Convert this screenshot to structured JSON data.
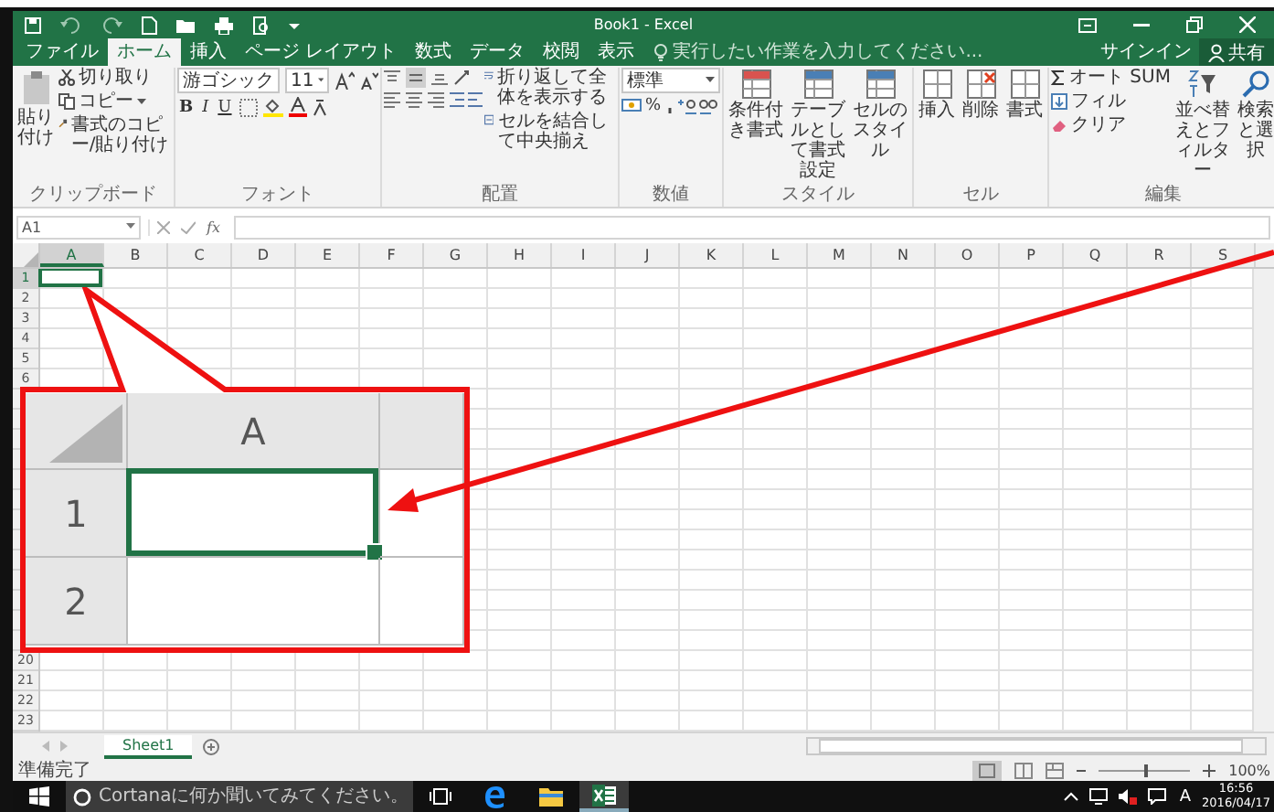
{
  "title_bar": {
    "title": "Book1 - Excel"
  },
  "tabs": [
    {
      "label": "ファイル",
      "selected": false
    },
    {
      "label": "ホーム",
      "selected": true
    },
    {
      "label": "挿入",
      "selected": false
    },
    {
      "label": "ページ レイアウト",
      "selected": false
    },
    {
      "label": "数式",
      "selected": false
    },
    {
      "label": "データ",
      "selected": false
    },
    {
      "label": "校閲",
      "selected": false
    },
    {
      "label": "表示",
      "selected": false
    }
  ],
  "tell_me": {
    "placeholder": "実行したい作業を入力してください..."
  },
  "account": {
    "sign_in": "サインイン",
    "share": "共有"
  },
  "ribbon": {
    "groups": [
      {
        "kind": "clipboard",
        "label": "クリップボード",
        "paste": "貼り付け",
        "cut": "切り取り",
        "copy": "コピー",
        "format_painter": "書式のコピー/貼り付け"
      },
      {
        "kind": "font",
        "label": "フォント",
        "font": "游ゴシック",
        "size": "11",
        "bold": "B",
        "italic": "I",
        "underline": "U"
      },
      {
        "kind": "alignment",
        "label": "配置",
        "wrap": "折り返して全体を表示する",
        "merge": "セルを結合して中央揃え"
      },
      {
        "kind": "number",
        "label": "数値",
        "format": "標準",
        "percent": "%"
      },
      {
        "kind": "styles",
        "label": "スタイル",
        "buttons": [
          "条件付き書式",
          "テーブルとして書式設定",
          "セルのスタイル"
        ]
      },
      {
        "kind": "cells",
        "label": "セル",
        "buttons": [
          "挿入",
          "削除",
          "書式"
        ]
      },
      {
        "kind": "editing",
        "label": "編集",
        "autosum": "オート SUM",
        "fill": "フィル",
        "clear": "クリア",
        "sort": "並べ替えとフィルター",
        "find": "検索と選択"
      }
    ]
  },
  "formula_bar": {
    "name_box": "A1",
    "fx": "fx"
  },
  "columns": [
    {
      "label": "A",
      "selected": true
    },
    {
      "label": "B",
      "selected": false
    },
    {
      "label": "C",
      "selected": false
    },
    {
      "label": "D",
      "selected": false
    },
    {
      "label": "E",
      "selected": false
    },
    {
      "label": "F",
      "selected": false
    },
    {
      "label": "G",
      "selected": false
    },
    {
      "label": "H",
      "selected": false
    },
    {
      "label": "I",
      "selected": false
    },
    {
      "label": "J",
      "selected": false
    },
    {
      "label": "K",
      "selected": false
    },
    {
      "label": "L",
      "selected": false
    },
    {
      "label": "M",
      "selected": false
    },
    {
      "label": "N",
      "selected": false
    },
    {
      "label": "O",
      "selected": false
    },
    {
      "label": "P",
      "selected": false
    },
    {
      "label": "Q",
      "selected": false
    },
    {
      "label": "R",
      "selected": false
    },
    {
      "label": "S",
      "selected": false
    }
  ],
  "rows_top": [
    {
      "label": "1",
      "selected": true
    },
    {
      "label": "2",
      "selected": false
    },
    {
      "label": "3",
      "selected": false
    },
    {
      "label": "4",
      "selected": false
    },
    {
      "label": "5",
      "selected": false
    },
    {
      "label": "6",
      "selected": false
    }
  ],
  "rows_bottom": [
    {
      "label": "20",
      "selected": false
    },
    {
      "label": "21",
      "selected": false
    },
    {
      "label": "22",
      "selected": false
    },
    {
      "label": "23",
      "selected": false
    }
  ],
  "callout": {
    "column": "A",
    "rows": [
      "1",
      "2"
    ]
  },
  "sheet_tabs": [
    {
      "label": "Sheet1",
      "selected": true
    }
  ],
  "status_bar": {
    "status": "準備完了",
    "zoom": {
      "level": 0.5,
      "reading": "100%"
    }
  },
  "taskbar": {
    "search": {
      "placeholder": "Cortanaに何か聞いてみてください。"
    },
    "ime": "A",
    "time": "16:56",
    "date": "2016/04/17"
  }
}
